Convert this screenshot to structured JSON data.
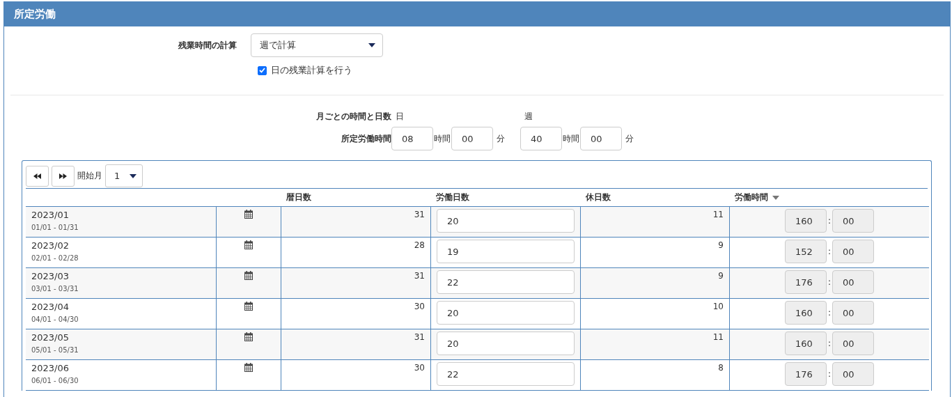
{
  "section": {
    "title": "所定労働"
  },
  "overtime": {
    "label": "残業時間の計算",
    "select": "週で計算",
    "daily_checkbox": {
      "label": "日の残業計算を行う",
      "checked": true
    }
  },
  "monthly": {
    "label": "月ごとの時間と日数",
    "hours_label": "所定労働時間",
    "groups": [
      {
        "heading": "日",
        "hours": "08",
        "hours_unit": "時間",
        "minutes": "00",
        "minutes_unit": "分"
      },
      {
        "heading": "週",
        "hours": "40",
        "hours_unit": "時間",
        "minutes": "00",
        "minutes_unit": "分"
      }
    ]
  },
  "pager": {
    "start_label": "開始月",
    "start_value": "1"
  },
  "table": {
    "columns": [
      {
        "label": "暦日数",
        "sortable": false
      },
      {
        "label": "労働日数",
        "sortable": false
      },
      {
        "label": "休日数",
        "sortable": false
      },
      {
        "label": "労働時間",
        "sortable": true
      }
    ],
    "rows": [
      {
        "month": "2023/01",
        "range": "01/01 - 01/31",
        "calendar_days": "31",
        "work_days": "20",
        "holidays": "11",
        "hours": "160",
        "separator": ":",
        "minutes": "00"
      },
      {
        "month": "2023/02",
        "range": "02/01 - 02/28",
        "calendar_days": "28",
        "work_days": "19",
        "holidays": "9",
        "hours": "152",
        "separator": ":",
        "minutes": "00"
      },
      {
        "month": "2023/03",
        "range": "03/01 - 03/31",
        "calendar_days": "31",
        "work_days": "22",
        "holidays": "9",
        "hours": "176",
        "separator": ":",
        "minutes": "00"
      },
      {
        "month": "2023/04",
        "range": "04/01 - 04/30",
        "calendar_days": "30",
        "work_days": "20",
        "holidays": "10",
        "hours": "160",
        "separator": ":",
        "minutes": "00"
      },
      {
        "month": "2023/05",
        "range": "05/01 - 05/31",
        "calendar_days": "31",
        "work_days": "20",
        "holidays": "11",
        "hours": "160",
        "separator": ":",
        "minutes": "00"
      },
      {
        "month": "2023/06",
        "range": "06/01 - 06/30",
        "calendar_days": "30",
        "work_days": "22",
        "holidays": "8",
        "hours": "176",
        "separator": ":",
        "minutes": "00"
      }
    ]
  }
}
